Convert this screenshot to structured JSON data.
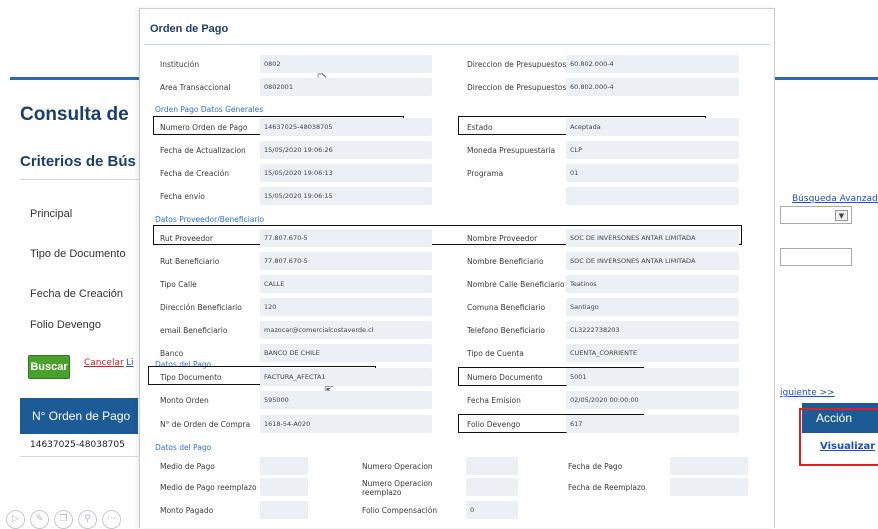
{
  "background": {
    "title": "Consulta de",
    "subtitle": "Criterios de Bús",
    "advanced_search": "Búsqueda Avanzada",
    "filters": [
      "Principal",
      "Tipo de Documento",
      "Fecha de Creación",
      "Folio Devengo"
    ],
    "search_button": "Buscar",
    "cancel_link": "Cancelar",
    "clear_link": "Li",
    "next_link": "iguiente >>",
    "table_header": "N° Orden de Pago",
    "table_row_value": "14637025-48038705",
    "action_header": "Acción",
    "view_link": "Visualizar"
  },
  "modal": {
    "title": "Orden de Pago",
    "sections": {
      "general": "Orden Pago Datos Generales",
      "supplier": "Datos Proveedor/Beneficiario",
      "payment": "Datos del Pago",
      "payment2": "Datos del Pago"
    },
    "rows": [
      {
        "label1": "Institución",
        "value1": "0802",
        "label2": "Direccion de Presupuestos",
        "value2": "60.802.000-4"
      },
      {
        "label1": "Area Transaccional",
        "value1": "0802001",
        "label2": "Direccion de Presupuestos",
        "value2": "60.802.000-4"
      },
      {
        "label1": "Numero Orden de Pago",
        "value1": "14637025-48038705",
        "label2": "Estado",
        "value2": "Aceptada"
      },
      {
        "label1": "Fecha de Actualizacion",
        "value1": "15/05/2020 19:06:26",
        "label2": "Moneda Presupuestaria",
        "value2": "CLP"
      },
      {
        "label1": "Fecha de Creación",
        "value1": "15/05/2020 19:06:13",
        "label2": "Programa",
        "value2": "01"
      },
      {
        "label1": "Fecha envío",
        "value1": "15/05/2020 19:06:15",
        "label2": "",
        "value2": ""
      },
      {
        "label1": "Rut Proveedor",
        "value1": "77.807.670-5",
        "label2": "Nombre Proveedor",
        "value2": "SOC DE INVERSONES ANTAR LIMITADA"
      },
      {
        "label1": "Rut Beneficiario",
        "value1": "77.807.670-5",
        "label2": "Nombre Beneficiario",
        "value2": "SOC DE INVERSONES ANTAR LIMITADA"
      },
      {
        "label1": "Tipo Calle",
        "value1": "CALLE",
        "label2": "Nombre Calle Beneficiario",
        "value2": "Teatinos"
      },
      {
        "label1": "Dirección Beneficiario",
        "value1": "120",
        "label2": "Comuna Beneficiario",
        "value2": "Santiago"
      },
      {
        "label1": "email Beneficiario",
        "value1": "mazocar@comercialcostaverde.cl",
        "label2": "Telefono Beneficiario",
        "value2": "CL3222738203"
      },
      {
        "label1": "Banco",
        "value1": "BANCO DE CHILE",
        "label2": "Tipo de Cuenta",
        "value2": "CUENTA_CORRIENTE"
      },
      {
        "label1": "Tipo Documento",
        "value1": "FACTURA_AFECTA1",
        "label2": "Numero Documento",
        "value2": "5001"
      },
      {
        "label1": "Monto Orden",
        "value1": "595000",
        "label2": "Fecha Emision",
        "value2": "02/05/2020 00:00:00"
      },
      {
        "label1": "N° de Orden de Compra",
        "value1": "1618-54-A020",
        "label2": "Folio Devengo",
        "value2": "617"
      }
    ],
    "pay_rows": [
      {
        "label1": "Medio de Pago",
        "value1": "",
        "label2": "Numero Operacion",
        "value2": "",
        "label3": "Fecha de Pago",
        "value3": ""
      },
      {
        "label1": "Medio de Pago reemplazo",
        "value1": "",
        "label2": "Numero Operacion reemplazo",
        "value2": "",
        "label3": "Fecha de Reemplazo",
        "value3": ""
      },
      {
        "label1": "Monto Pagado",
        "value1": "",
        "label2": "Folio Compensación",
        "value2": "0",
        "label3": "",
        "value3": ""
      }
    ]
  },
  "colors": {
    "accent": "#1d5b96",
    "section_label": "#2f6ee0",
    "highlight_box": "#111111",
    "red_box": "#e02020"
  }
}
